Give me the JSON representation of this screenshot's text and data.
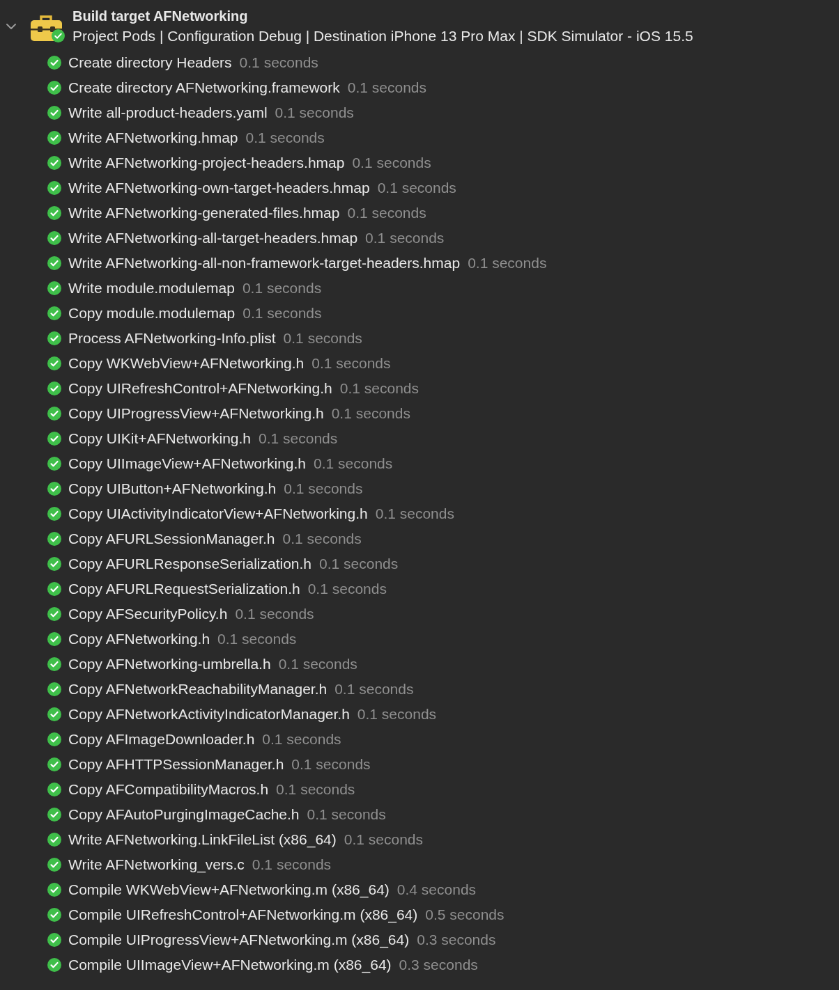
{
  "target": {
    "expanded": true,
    "title": "Build target AFNetworking",
    "subtitle": "Project Pods | Configuration Debug | Destination iPhone 13 Pro Max | SDK Simulator - iOS 15.5",
    "succeeded": true
  },
  "steps": [
    {
      "succeeded": true,
      "name": "Create directory Headers",
      "duration": "0.1 seconds"
    },
    {
      "succeeded": true,
      "name": "Create directory AFNetworking.framework",
      "duration": "0.1 seconds"
    },
    {
      "succeeded": true,
      "name": "Write all-product-headers.yaml",
      "duration": "0.1 seconds"
    },
    {
      "succeeded": true,
      "name": "Write AFNetworking.hmap",
      "duration": "0.1 seconds"
    },
    {
      "succeeded": true,
      "name": "Write AFNetworking-project-headers.hmap",
      "duration": "0.1 seconds"
    },
    {
      "succeeded": true,
      "name": "Write AFNetworking-own-target-headers.hmap",
      "duration": "0.1 seconds"
    },
    {
      "succeeded": true,
      "name": "Write AFNetworking-generated-files.hmap",
      "duration": "0.1 seconds"
    },
    {
      "succeeded": true,
      "name": "Write AFNetworking-all-target-headers.hmap",
      "duration": "0.1 seconds"
    },
    {
      "succeeded": true,
      "name": "Write AFNetworking-all-non-framework-target-headers.hmap",
      "duration": "0.1 seconds"
    },
    {
      "succeeded": true,
      "name": "Write module.modulemap",
      "duration": "0.1 seconds"
    },
    {
      "succeeded": true,
      "name": "Copy module.modulemap",
      "duration": "0.1 seconds"
    },
    {
      "succeeded": true,
      "name": "Process AFNetworking-Info.plist",
      "duration": "0.1 seconds"
    },
    {
      "succeeded": true,
      "name": "Copy WKWebView+AFNetworking.h",
      "duration": "0.1 seconds"
    },
    {
      "succeeded": true,
      "name": "Copy UIRefreshControl+AFNetworking.h",
      "duration": "0.1 seconds"
    },
    {
      "succeeded": true,
      "name": "Copy UIProgressView+AFNetworking.h",
      "duration": "0.1 seconds"
    },
    {
      "succeeded": true,
      "name": "Copy UIKit+AFNetworking.h",
      "duration": "0.1 seconds"
    },
    {
      "succeeded": true,
      "name": "Copy UIImageView+AFNetworking.h",
      "duration": "0.1 seconds"
    },
    {
      "succeeded": true,
      "name": "Copy UIButton+AFNetworking.h",
      "duration": "0.1 seconds"
    },
    {
      "succeeded": true,
      "name": "Copy UIActivityIndicatorView+AFNetworking.h",
      "duration": "0.1 seconds"
    },
    {
      "succeeded": true,
      "name": "Copy AFURLSessionManager.h",
      "duration": "0.1 seconds"
    },
    {
      "succeeded": true,
      "name": "Copy AFURLResponseSerialization.h",
      "duration": "0.1 seconds"
    },
    {
      "succeeded": true,
      "name": "Copy AFURLRequestSerialization.h",
      "duration": "0.1 seconds"
    },
    {
      "succeeded": true,
      "name": "Copy AFSecurityPolicy.h",
      "duration": "0.1 seconds"
    },
    {
      "succeeded": true,
      "name": "Copy AFNetworking.h",
      "duration": "0.1 seconds"
    },
    {
      "succeeded": true,
      "name": "Copy AFNetworking-umbrella.h",
      "duration": "0.1 seconds"
    },
    {
      "succeeded": true,
      "name": "Copy AFNetworkReachabilityManager.h",
      "duration": "0.1 seconds"
    },
    {
      "succeeded": true,
      "name": "Copy AFNetworkActivityIndicatorManager.h",
      "duration": "0.1 seconds"
    },
    {
      "succeeded": true,
      "name": "Copy AFImageDownloader.h",
      "duration": "0.1 seconds"
    },
    {
      "succeeded": true,
      "name": "Copy AFHTTPSessionManager.h",
      "duration": "0.1 seconds"
    },
    {
      "succeeded": true,
      "name": "Copy AFCompatibilityMacros.h",
      "duration": "0.1 seconds"
    },
    {
      "succeeded": true,
      "name": "Copy AFAutoPurgingImageCache.h",
      "duration": "0.1 seconds"
    },
    {
      "succeeded": true,
      "name": "Write AFNetworking.LinkFileList (x86_64)",
      "duration": "0.1 seconds"
    },
    {
      "succeeded": true,
      "name": "Write AFNetworking_vers.c",
      "duration": "0.1 seconds"
    },
    {
      "succeeded": true,
      "name": "Compile WKWebView+AFNetworking.m (x86_64)",
      "duration": "0.4 seconds"
    },
    {
      "succeeded": true,
      "name": "Compile UIRefreshControl+AFNetworking.m (x86_64)",
      "duration": "0.5 seconds"
    },
    {
      "succeeded": true,
      "name": "Compile UIProgressView+AFNetworking.m (x86_64)",
      "duration": "0.3 seconds"
    },
    {
      "succeeded": true,
      "name": "Compile UIImageView+AFNetworking.m (x86_64)",
      "duration": "0.3 seconds"
    }
  ]
}
